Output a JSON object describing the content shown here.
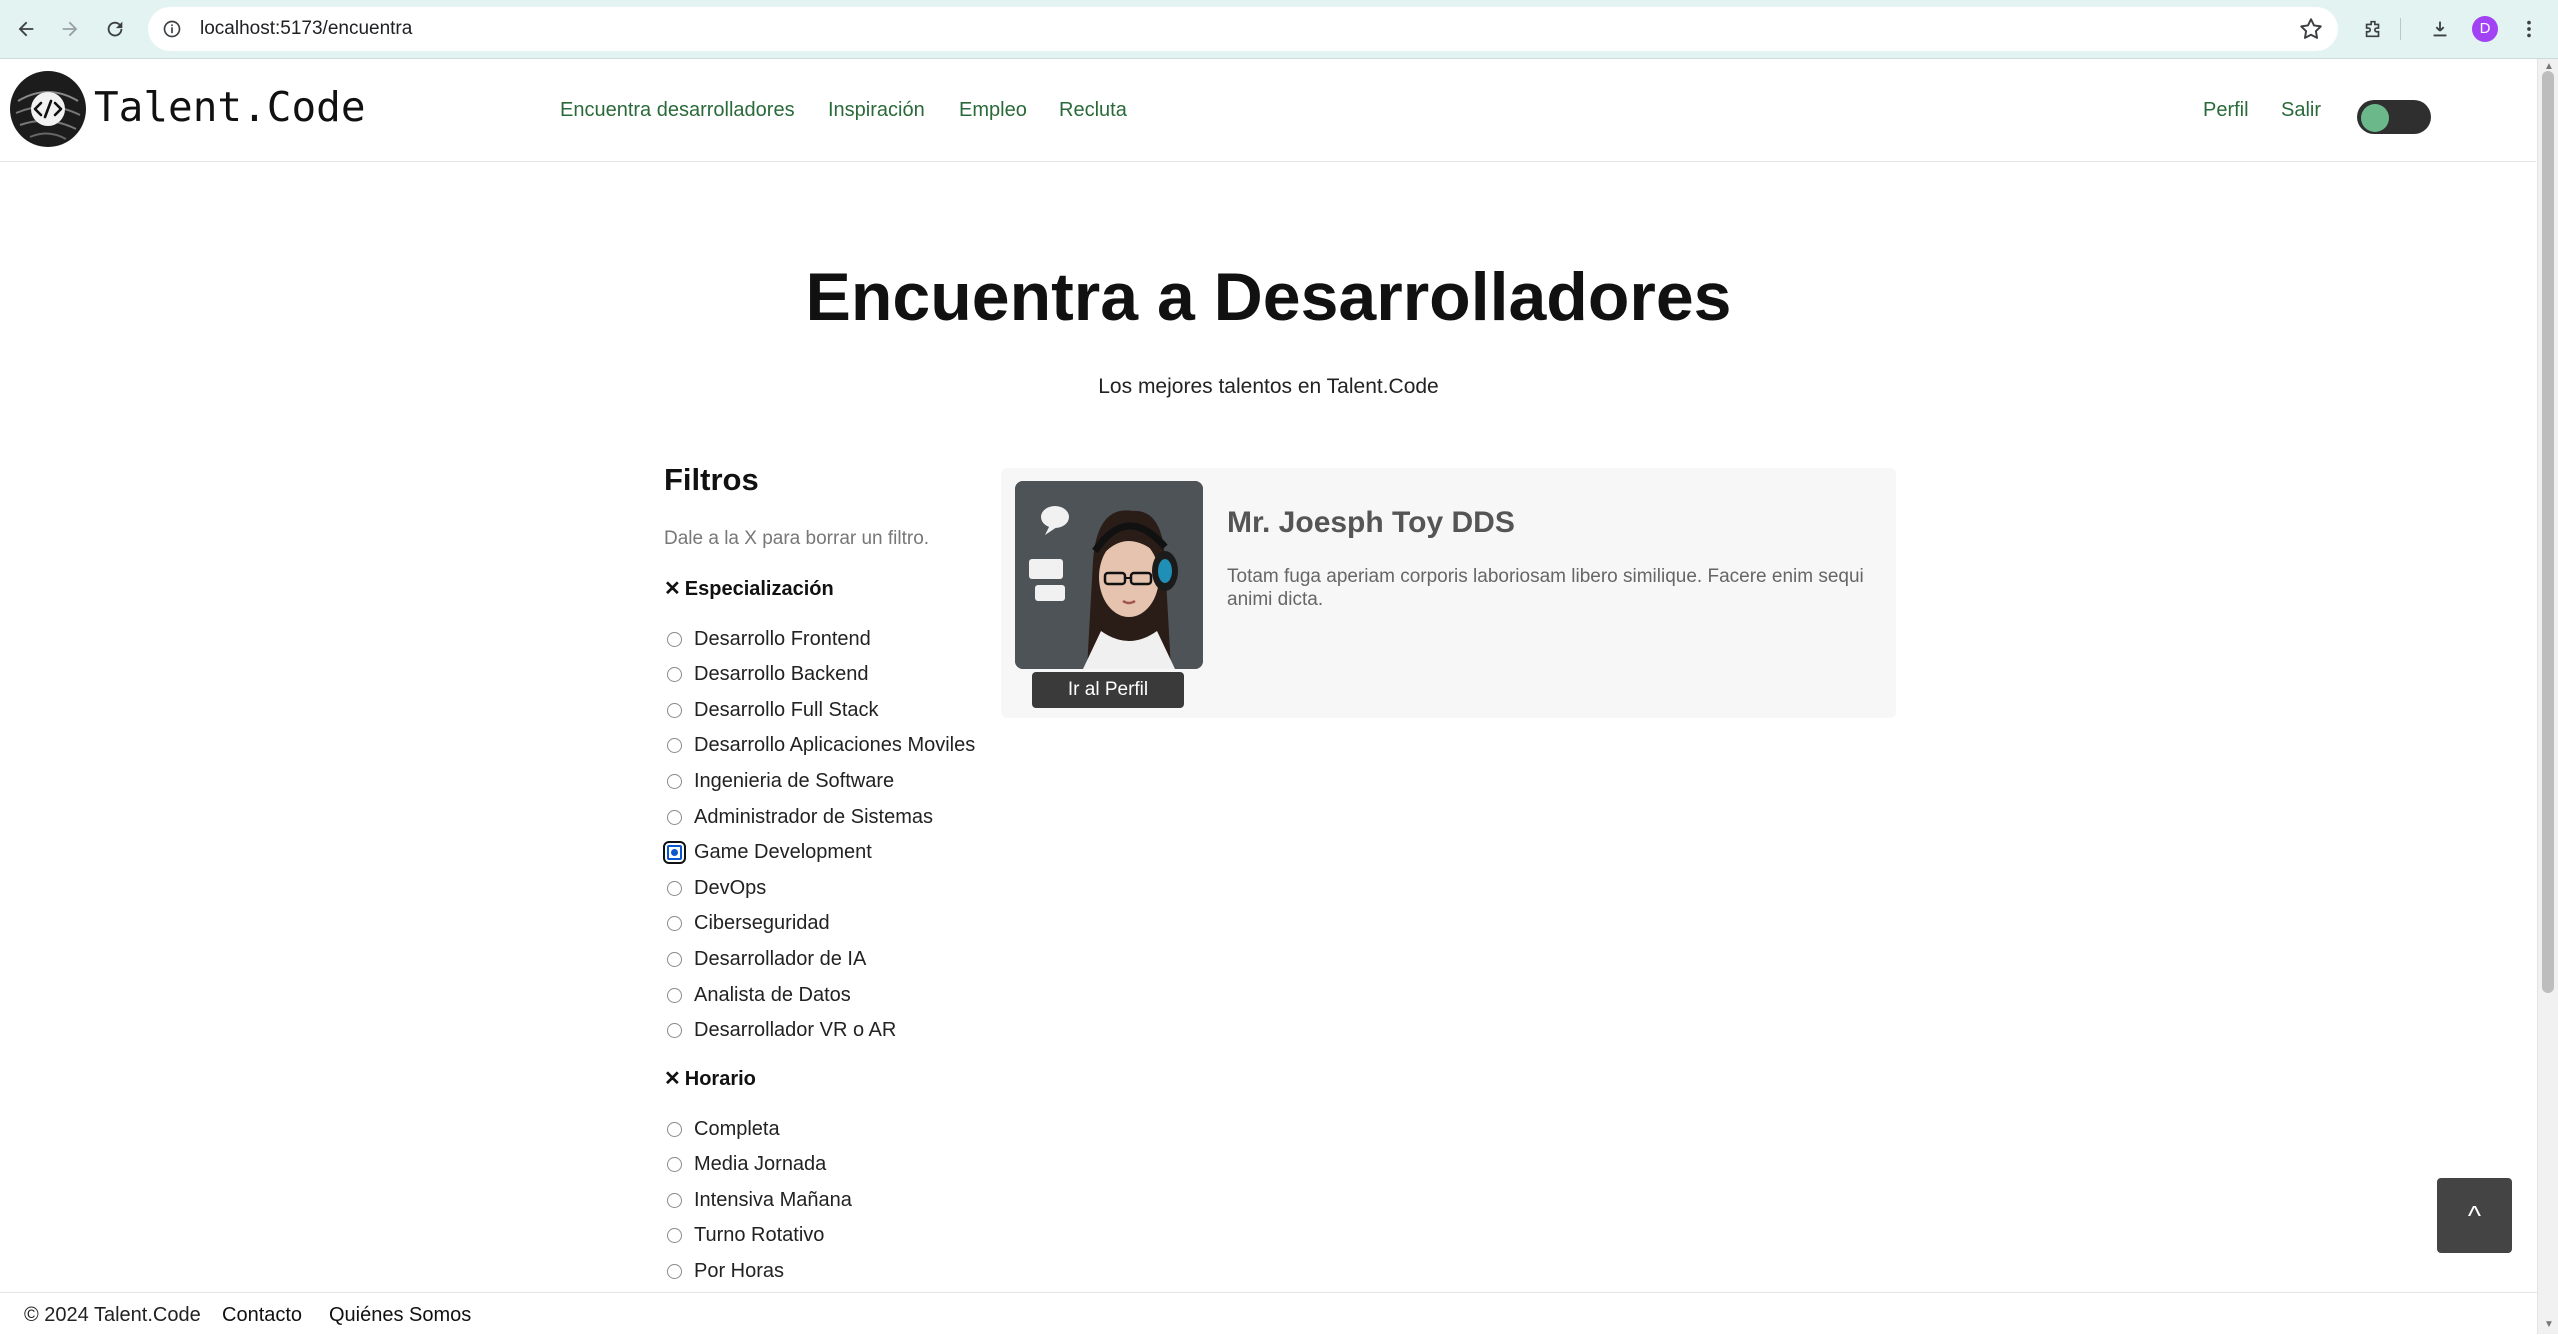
{
  "browser": {
    "url": "localhost:5173/encuentra",
    "profile_initial": "D"
  },
  "header": {
    "brand": "Talent.Code",
    "nav": [
      "Encuentra desarrolladores",
      "Inspiración",
      "Empleo",
      "Recluta"
    ],
    "right_links": [
      "Perfil",
      "Salir"
    ],
    "theme_toggle": "on"
  },
  "hero": {
    "title": "Encuentra a Desarrolladores",
    "subtitle": "Los mejores talentos en Talent.Code"
  },
  "filters": {
    "title": "Filtros",
    "hint": "Dale a la X para borrar un filtro.",
    "groups": [
      {
        "title": "Especialización",
        "clear": "✕",
        "options": [
          "Desarrollo Frontend",
          "Desarrollo Backend",
          "Desarrollo Full Stack",
          "Desarrollo Aplicaciones Moviles",
          "Ingenieria de Software",
          "Administrador de Sistemas",
          "Game Development",
          "DevOps",
          "Ciberseguridad",
          "Desarrollador de IA",
          "Analista de Datos",
          "Desarrollador VR o AR"
        ],
        "selected": "Game Development"
      },
      {
        "title": "Horario",
        "clear": "✕",
        "options": [
          "Completa",
          "Media Jornada",
          "Intensiva Mañana",
          "Turno Rotativo",
          "Por Horas"
        ],
        "selected": null
      }
    ]
  },
  "results": [
    {
      "name": "Mr. Joesph Toy DDS",
      "description": "Totam fuga aperiam corporis laboriosam libero similique. Facere enim sequi animi dicta.",
      "button": "Ir al Perfil"
    }
  ],
  "back_to_top": "^",
  "footer": {
    "copyright": "© 2024 Talent.Code",
    "links": [
      "Contacto",
      "Quiénes Somos"
    ]
  },
  "colors": {
    "nav_link": "#2a6a3a",
    "toggle_knob": "#6bb98a",
    "radio_checked": "#0b57d0",
    "toolbar": "#e2f3f1"
  }
}
